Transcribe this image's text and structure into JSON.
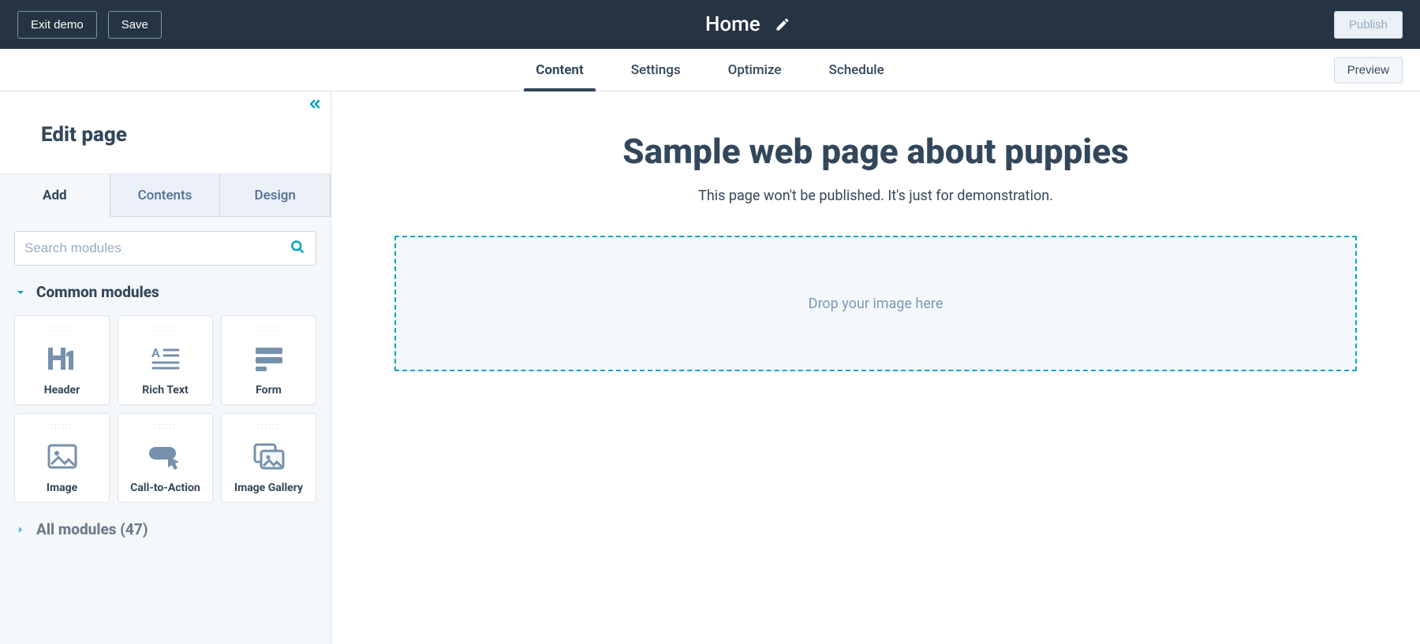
{
  "topbar": {
    "exit_label": "Exit demo",
    "save_label": "Save",
    "page_title": "Home",
    "publish_label": "Publish"
  },
  "subnav": {
    "tabs": [
      "Content",
      "Settings",
      "Optimize",
      "Schedule"
    ],
    "active_index": 0,
    "preview_label": "Preview"
  },
  "sidebar": {
    "title": "Edit page",
    "tabs": [
      "Add",
      "Contents",
      "Design"
    ],
    "active_index": 0,
    "search_placeholder": "Search modules",
    "common_section_title": "Common modules",
    "modules": [
      {
        "label": "Header",
        "icon": "h1"
      },
      {
        "label": "Rich Text",
        "icon": "richtext"
      },
      {
        "label": "Form",
        "icon": "form"
      },
      {
        "label": "Image",
        "icon": "image"
      },
      {
        "label": "Call-to-Action",
        "icon": "cta"
      },
      {
        "label": "Image Gallery",
        "icon": "gallery"
      }
    ],
    "all_section_title": "All modules (47)"
  },
  "canvas": {
    "title": "Sample web page about puppies",
    "subtitle": "This page won't be published. It's just for demonstration.",
    "dropzone_label": "Drop your image here"
  },
  "colors": {
    "dark": "#253342",
    "text": "#33475b",
    "accent": "#00a4bd",
    "muted": "#7c98b6",
    "border": "#cbd6e2",
    "panel": "#f5f8fa"
  }
}
